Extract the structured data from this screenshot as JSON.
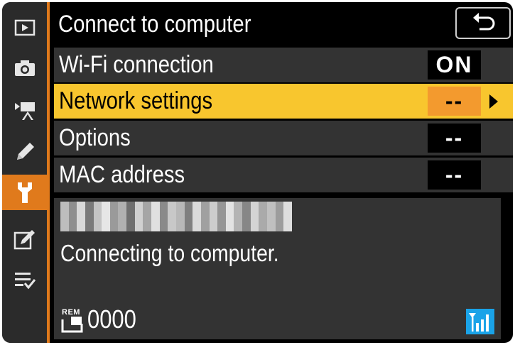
{
  "header": {
    "title": "Connect to computer",
    "back_icon": "return-arrow-icon"
  },
  "tabs": [
    {
      "name": "playback-menu-icon",
      "active": false
    },
    {
      "name": "photo-shooting-menu-icon",
      "active": false
    },
    {
      "name": "movie-recording-menu-icon",
      "active": false
    },
    {
      "name": "custom-settings-menu-icon",
      "active": false
    },
    {
      "name": "setup-menu-icon",
      "active": true
    },
    {
      "name": "retouch-menu-icon",
      "active": false
    },
    {
      "name": "my-menu-icon",
      "active": false
    }
  ],
  "menu": {
    "items": [
      {
        "label": "Wi-Fi connection",
        "value": "ON",
        "selected": false
      },
      {
        "label": "Network settings",
        "value": "--",
        "selected": true
      },
      {
        "label": "Options",
        "value": "--",
        "selected": false
      },
      {
        "label": "MAC address",
        "value": "--",
        "selected": false
      }
    ]
  },
  "info": {
    "status": "Connecting to computer.",
    "remaining_label": "REM",
    "remaining_count": "0000",
    "signal_icon": "wifi-signal-strength-icon"
  },
  "colors": {
    "accent_orange": "#e07a1c",
    "highlight_yellow": "#f8c62e",
    "value_highlight": "#f39a2e",
    "signal_blue": "#1aa3e8",
    "row_bg": "#333333"
  }
}
